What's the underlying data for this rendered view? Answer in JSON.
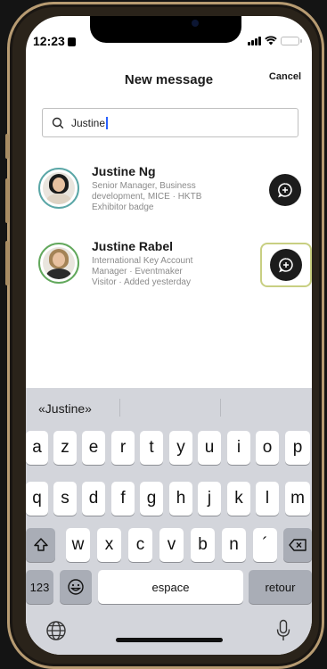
{
  "status_bar": {
    "time": "12:23"
  },
  "header": {
    "title": "New message",
    "cancel_label": "Cancel"
  },
  "search": {
    "value": "Justine"
  },
  "contacts": [
    {
      "name": "Justine Ng",
      "line1": "Senior Manager, Business",
      "line2": "development, MICE · HKTB",
      "line3": "Exhibitor badge",
      "ring_color": "#5aa6a6"
    },
    {
      "name": "Justine Rabel",
      "line1": "International Key Account",
      "line2": "Manager · Eventmaker",
      "line3": "Visitor · Added yesterday",
      "ring_color": "#62a85c"
    }
  ],
  "keyboard": {
    "suggestion": "«Justine»",
    "row1": [
      "a",
      "z",
      "e",
      "r",
      "t",
      "y",
      "u",
      "i",
      "o",
      "p"
    ],
    "row2": [
      "q",
      "s",
      "d",
      "f",
      "g",
      "h",
      "j",
      "k",
      "l",
      "m"
    ],
    "row3": [
      "w",
      "x",
      "c",
      "v",
      "b",
      "n",
      "´"
    ],
    "numbers_label": "123",
    "space_label": "espace",
    "return_label": "retour"
  },
  "icons": {
    "search": "search-icon",
    "message": "message-plus-icon",
    "shift": "shift-icon",
    "backspace": "backspace-icon",
    "emoji": "emoji-icon",
    "globe": "globe-icon",
    "mic": "microphone-icon"
  },
  "colors": {
    "highlight": "#c8cf82",
    "caret": "#2b62ff"
  }
}
